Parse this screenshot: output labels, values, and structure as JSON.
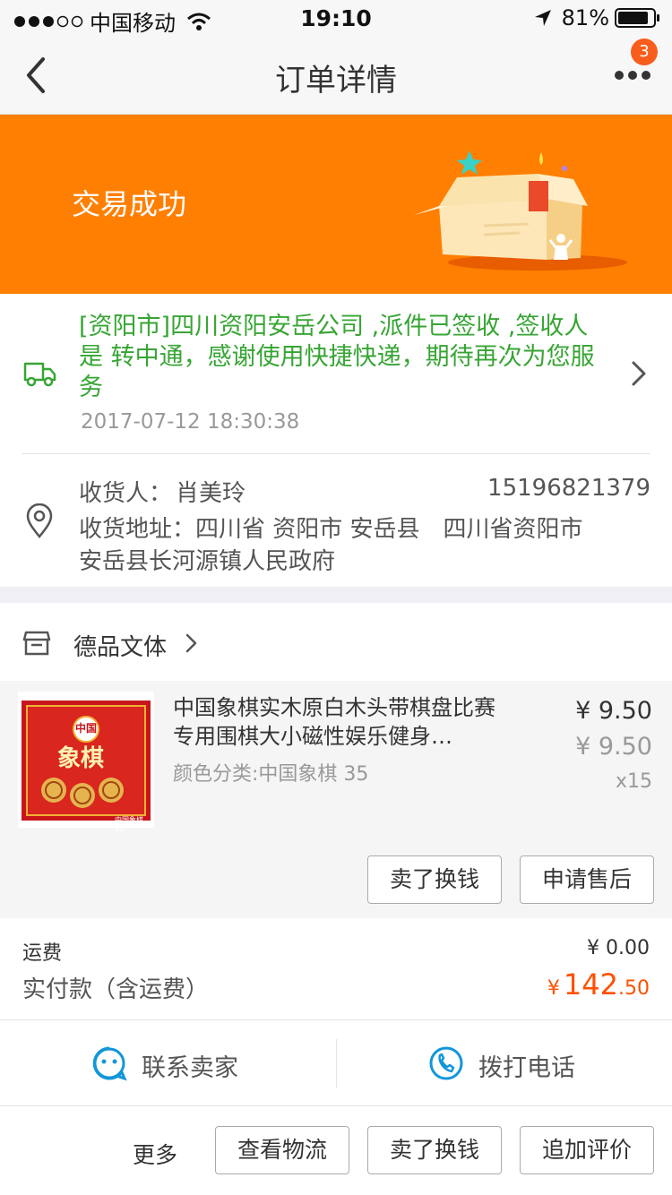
{
  "status_bar": {
    "carrier": "中国移动",
    "time": "19:10",
    "battery": "81%"
  },
  "nav": {
    "title": "订单详情",
    "badge_count": "3"
  },
  "banner": {
    "status": "交易成功"
  },
  "logistics": {
    "message": "[资阳市]四川资阳安岳公司 ,派件已签收 ,签收人是 转中通，感谢使用快捷快递，期待再次为您服务",
    "time": "2017-07-12 18:30:38"
  },
  "address": {
    "receiver_label": "收货人：",
    "receiver_name": "肖美玲",
    "phone": "15196821379",
    "address_label": "收货地址：",
    "address_line1": "四川省 资阳市 安岳县　四川省资阳市",
    "address_line2": "安岳县长河源镇人民政府"
  },
  "store": {
    "name": "德品文体"
  },
  "product": {
    "title": "中国象棋实木原白木头带棋盘比赛专用围棋大小磁性娱乐健身…",
    "sku": "颜色分类:中国象棋  35",
    "price": "¥ 9.50",
    "original_price": "¥ 9.50",
    "quantity": "x15",
    "image_caption_top": "中国",
    "image_caption_main": "象棋",
    "image_caption_bottom": "中国象棋 35",
    "actions": [
      "卖了换钱",
      "申请售后"
    ]
  },
  "summary": {
    "shipping_label": "运费",
    "shipping_value": "¥ 0.00",
    "paid_label": "实付款（含运费）",
    "paid_currency": "¥",
    "paid_integer": "142",
    "paid_decimal": ".50"
  },
  "contact": {
    "seller": "联系卖家",
    "call": "拨打电话"
  },
  "footer": {
    "more": "更多",
    "buttons": [
      "查看物流",
      "卖了换钱",
      "追加评价"
    ]
  },
  "colors": {
    "accent": "#ff7f02",
    "logistics_green": "#37a534",
    "price_orange": "#ff5000",
    "contact_blue": "#1296db"
  }
}
